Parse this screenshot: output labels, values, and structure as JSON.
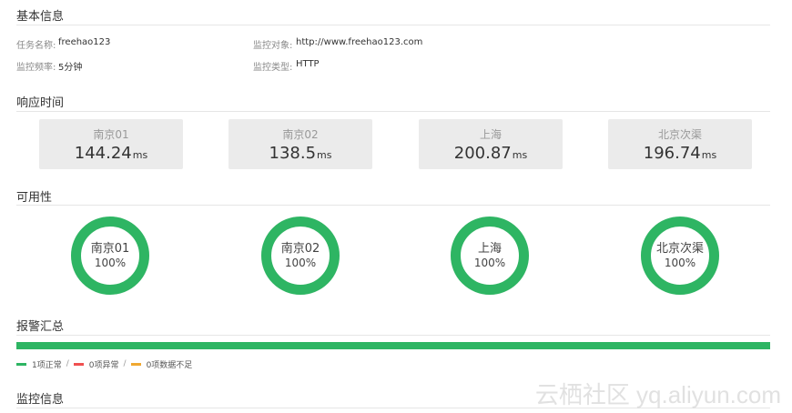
{
  "basic_info": {
    "title": "基本信息",
    "task_name_label": "任务名称:",
    "task_name_value": "freehao123",
    "monitor_target_label": "监控对象:",
    "monitor_target_value": "http://www.freehao123.com",
    "monitor_freq_label": "监控频率:",
    "monitor_freq_value": "5分钟",
    "monitor_type_label": "监控类型:",
    "monitor_type_value": "HTTP"
  },
  "response_time": {
    "title": "响应时间",
    "unit": "ms",
    "cards": [
      {
        "name": "南京01",
        "value": "144.24"
      },
      {
        "name": "南京02",
        "value": "138.5"
      },
      {
        "name": "上海",
        "value": "200.87"
      },
      {
        "name": "北京次渠",
        "value": "196.74"
      }
    ]
  },
  "availability": {
    "title": "可用性",
    "items": [
      {
        "name": "南京01",
        "percent": "100%",
        "value": 100
      },
      {
        "name": "南京02",
        "percent": "100%",
        "value": 100
      },
      {
        "name": "上海",
        "percent": "100%",
        "value": 100
      },
      {
        "name": "北京次渠",
        "percent": "100%",
        "value": 100
      }
    ],
    "ring_color": "#2eb563"
  },
  "alerts": {
    "title": "报警汇总",
    "legend": [
      {
        "label": "1项正常",
        "color": "#2eb563"
      },
      {
        "label": "0项异常",
        "color": "#f05050"
      },
      {
        "label": "0项数据不足",
        "color": "#f0a830"
      }
    ],
    "separator": "/",
    "normal_fraction": 1.0
  },
  "monitor_info": {
    "title": "监控信息"
  },
  "watermark": "云栖社区 yq.aliyun.com"
}
